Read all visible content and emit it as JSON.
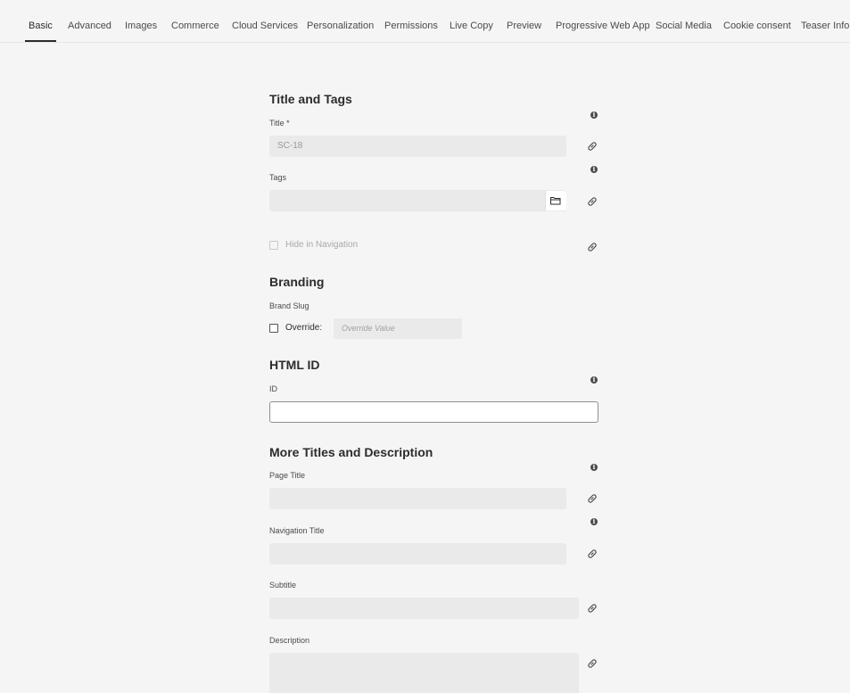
{
  "tabs": [
    {
      "label": "Basic"
    },
    {
      "label": "Advanced"
    },
    {
      "label": "Images"
    },
    {
      "label": "Commerce"
    },
    {
      "label": "Cloud Services"
    },
    {
      "label": "Personalization"
    },
    {
      "label": "Permissions"
    },
    {
      "label": "Live Copy"
    },
    {
      "label": "Preview"
    },
    {
      "label": "Progressive Web App"
    },
    {
      "label": "Social Media"
    },
    {
      "label": "Cookie consent"
    },
    {
      "label": "Teaser Info"
    }
  ],
  "title_tags": {
    "heading": "Title and Tags",
    "title_label": "Title *",
    "title_value": "SC-18",
    "tags_label": "Tags",
    "tags_value": "",
    "hide_nav_label": "Hide in Navigation"
  },
  "branding": {
    "heading": "Branding",
    "brand_slug_label": "Brand Slug",
    "override_label": "Override:",
    "override_placeholder": "Override Value"
  },
  "html_id": {
    "heading": "HTML ID",
    "id_label": "ID",
    "id_value": ""
  },
  "more_titles": {
    "heading": "More Titles and Description",
    "page_title_label": "Page Title",
    "nav_title_label": "Navigation Title",
    "subtitle_label": "Subtitle",
    "description_label": "Description"
  },
  "icons": {
    "info": "info-icon",
    "link": "link-icon",
    "folder": "folder-icon"
  }
}
